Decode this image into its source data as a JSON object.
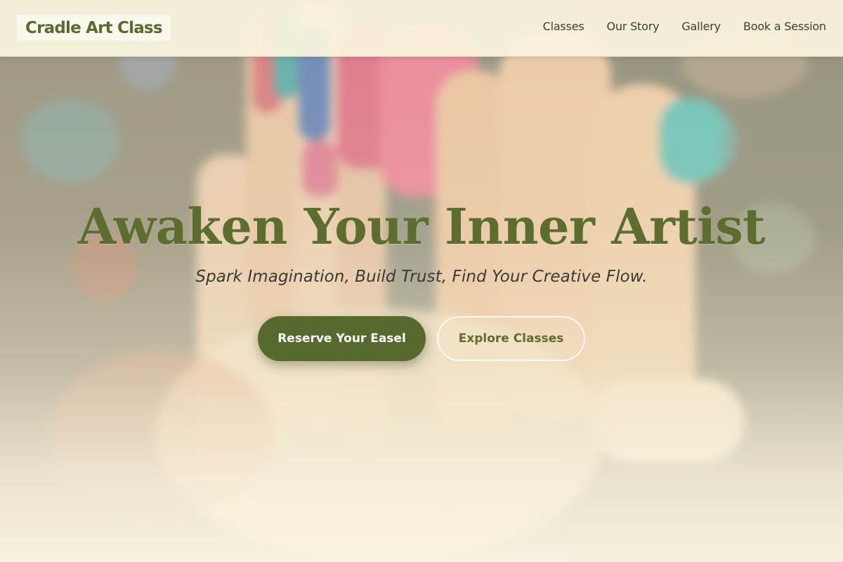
{
  "brand": {
    "name": "Cradle Art Class"
  },
  "nav": {
    "items": [
      {
        "label": "Classes"
      },
      {
        "label": "Our Story"
      },
      {
        "label": "Gallery"
      },
      {
        "label": "Book a Session"
      }
    ]
  },
  "hero": {
    "title": "Awaken Your Inner Artist",
    "subtitle": "Spark Imagination, Build Trust, Find Your Creative Flow.",
    "primary_button": "Reserve Your Easel",
    "secondary_button": "Explore Classes",
    "background_image": "painted-hands-icon"
  },
  "colors": {
    "accent_green": "#566a2d",
    "title_green": "#5b6e2e",
    "cream": "#f7f1da",
    "text_dark": "#3d3d36"
  }
}
